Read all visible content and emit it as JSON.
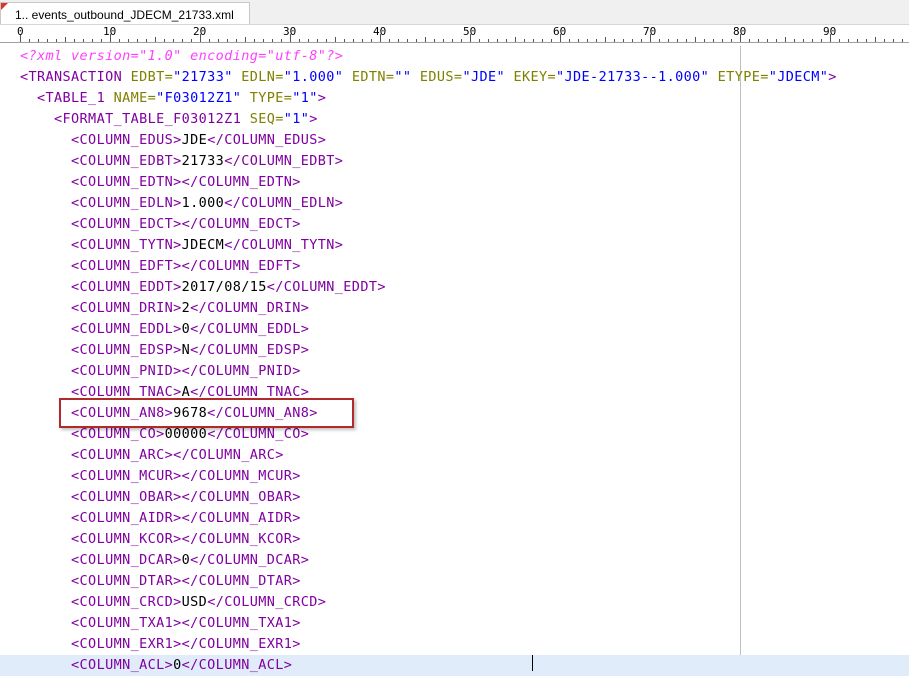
{
  "tab": {
    "title": "1.. events_outbound_JDECM_21733.xml"
  },
  "ruler": {
    "labels": [
      "0",
      "10",
      "20",
      "30",
      "40",
      "50",
      "60",
      "70",
      "80",
      "90"
    ]
  },
  "lines": [
    [
      [
        "pi",
        "<?xml version=\"1.0\" encoding=\"utf-8\"?>"
      ]
    ],
    [
      [
        "tag",
        "<TRANSACTION "
      ],
      [
        "attr",
        "EDBT="
      ],
      [
        "val",
        "\"21733\""
      ],
      [
        "attr",
        " EDLN="
      ],
      [
        "val",
        "\"1.000\""
      ],
      [
        "attr",
        " EDTN="
      ],
      [
        "val",
        "\"\""
      ],
      [
        "attr",
        " EDUS="
      ],
      [
        "val",
        "\"JDE\""
      ],
      [
        "attr",
        " EKEY="
      ],
      [
        "val",
        "\"JDE-21733--1.000\""
      ],
      [
        "attr",
        " ETYPE="
      ],
      [
        "val",
        "\"JDECM\""
      ],
      [
        "tag",
        ">"
      ]
    ],
    [
      [
        "text",
        "  "
      ],
      [
        "tag",
        "<TABLE_1 "
      ],
      [
        "attr",
        "NAME="
      ],
      [
        "val",
        "\"F03012Z1\""
      ],
      [
        "attr",
        " TYPE="
      ],
      [
        "val",
        "\"1\""
      ],
      [
        "tag",
        ">"
      ]
    ],
    [
      [
        "text",
        "    "
      ],
      [
        "tag",
        "<FORMAT_TABLE_F03012Z1 "
      ],
      [
        "attr",
        "SEQ="
      ],
      [
        "val",
        "\"1\""
      ],
      [
        "tag",
        ">"
      ]
    ],
    [
      [
        "text",
        "      "
      ],
      [
        "tag",
        "<COLUMN_EDUS>"
      ],
      [
        "text",
        "JDE"
      ],
      [
        "tag",
        "</COLUMN_EDUS>"
      ]
    ],
    [
      [
        "text",
        "      "
      ],
      [
        "tag",
        "<COLUMN_EDBT>"
      ],
      [
        "text",
        "21733"
      ],
      [
        "tag",
        "</COLUMN_EDBT>"
      ]
    ],
    [
      [
        "text",
        "      "
      ],
      [
        "tag",
        "<COLUMN_EDTN></COLUMN_EDTN>"
      ]
    ],
    [
      [
        "text",
        "      "
      ],
      [
        "tag",
        "<COLUMN_EDLN>"
      ],
      [
        "text",
        "1.000"
      ],
      [
        "tag",
        "</COLUMN_EDLN>"
      ]
    ],
    [
      [
        "text",
        "      "
      ],
      [
        "tag",
        "<COLUMN_EDCT></COLUMN_EDCT>"
      ]
    ],
    [
      [
        "text",
        "      "
      ],
      [
        "tag",
        "<COLUMN_TYTN>"
      ],
      [
        "text",
        "JDECM"
      ],
      [
        "tag",
        "</COLUMN_TYTN>"
      ]
    ],
    [
      [
        "text",
        "      "
      ],
      [
        "tag",
        "<COLUMN_EDFT></COLUMN_EDFT>"
      ]
    ],
    [
      [
        "text",
        "      "
      ],
      [
        "tag",
        "<COLUMN_EDDT>"
      ],
      [
        "text",
        "2017/08/15"
      ],
      [
        "tag",
        "</COLUMN_EDDT>"
      ]
    ],
    [
      [
        "text",
        "      "
      ],
      [
        "tag",
        "<COLUMN_DRIN>"
      ],
      [
        "text",
        "2"
      ],
      [
        "tag",
        "</COLUMN_DRIN>"
      ]
    ],
    [
      [
        "text",
        "      "
      ],
      [
        "tag",
        "<COLUMN_EDDL>"
      ],
      [
        "text",
        "0"
      ],
      [
        "tag",
        "</COLUMN_EDDL>"
      ]
    ],
    [
      [
        "text",
        "      "
      ],
      [
        "tag",
        "<COLUMN_EDSP>"
      ],
      [
        "text",
        "N"
      ],
      [
        "tag",
        "</COLUMN_EDSP>"
      ]
    ],
    [
      [
        "text",
        "      "
      ],
      [
        "tag",
        "<COLUMN_PNID></COLUMN_PNID>"
      ]
    ],
    [
      [
        "text",
        "      "
      ],
      [
        "tag",
        "<COLUMN_TNAC>"
      ],
      [
        "text",
        "A"
      ],
      [
        "tag",
        "</COLUMN_TNAC>"
      ]
    ],
    [
      [
        "text",
        "      "
      ],
      [
        "tag",
        "<COLUMN_AN8>"
      ],
      [
        "text",
        "9678"
      ],
      [
        "tag",
        "</COLUMN_AN8>"
      ]
    ],
    [
      [
        "text",
        "      "
      ],
      [
        "tag",
        "<COLUMN_CO>"
      ],
      [
        "text",
        "00000"
      ],
      [
        "tag",
        "</COLUMN_CO>"
      ]
    ],
    [
      [
        "text",
        "      "
      ],
      [
        "tag",
        "<COLUMN_ARC></COLUMN_ARC>"
      ]
    ],
    [
      [
        "text",
        "      "
      ],
      [
        "tag",
        "<COLUMN_MCUR></COLUMN_MCUR>"
      ]
    ],
    [
      [
        "text",
        "      "
      ],
      [
        "tag",
        "<COLUMN_OBAR></COLUMN_OBAR>"
      ]
    ],
    [
      [
        "text",
        "      "
      ],
      [
        "tag",
        "<COLUMN_AIDR></COLUMN_AIDR>"
      ]
    ],
    [
      [
        "text",
        "      "
      ],
      [
        "tag",
        "<COLUMN_KCOR></COLUMN_KCOR>"
      ]
    ],
    [
      [
        "text",
        "      "
      ],
      [
        "tag",
        "<COLUMN_DCAR>"
      ],
      [
        "text",
        "0"
      ],
      [
        "tag",
        "</COLUMN_DCAR>"
      ]
    ],
    [
      [
        "text",
        "      "
      ],
      [
        "tag",
        "<COLUMN_DTAR></COLUMN_DTAR>"
      ]
    ],
    [
      [
        "text",
        "      "
      ],
      [
        "tag",
        "<COLUMN_CRCD>"
      ],
      [
        "text",
        "USD"
      ],
      [
        "tag",
        "</COLUMN_CRCD>"
      ]
    ],
    [
      [
        "text",
        "      "
      ],
      [
        "tag",
        "<COLUMN_TXA1></COLUMN_TXA1>"
      ]
    ],
    [
      [
        "text",
        "      "
      ],
      [
        "tag",
        "<COLUMN_EXR1></COLUMN_EXR1>"
      ]
    ],
    [
      [
        "text",
        "      "
      ],
      [
        "tag",
        "<COLUMN_ACL>"
      ],
      [
        "text",
        "0"
      ],
      [
        "tag",
        "</COLUMN_ACL>"
      ]
    ]
  ],
  "current_line": 29,
  "highlighted_line": 17,
  "colors": {
    "tag": "#8000a0",
    "attribute": "#808000",
    "value": "#0000ff",
    "text": "#000000",
    "processing_instruction": "#ff40ff",
    "current_line_bg": "#e0ecfa",
    "highlight_border": "#b02a2a"
  }
}
